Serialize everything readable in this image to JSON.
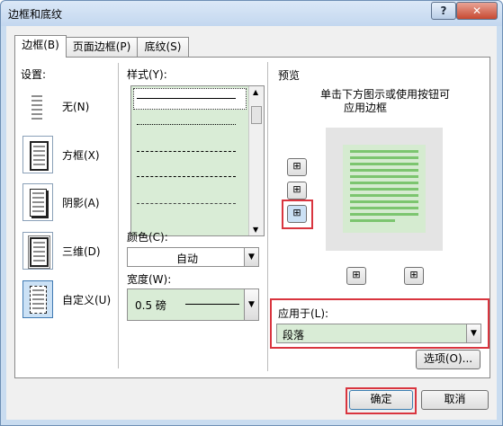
{
  "window": {
    "title": "边框和底纹",
    "help": "?",
    "close": "✕"
  },
  "tabs": [
    {
      "label": "边框(B)"
    },
    {
      "label": "页面边框(P)"
    },
    {
      "label": "底纹(S)"
    }
  ],
  "settings": {
    "label": "设置:",
    "items": [
      {
        "label": "无(N)"
      },
      {
        "label": "方框(X)"
      },
      {
        "label": "阴影(A)"
      },
      {
        "label": "三维(D)"
      },
      {
        "label": "自定义(U)"
      }
    ]
  },
  "style": {
    "label": "样式(Y):"
  },
  "color": {
    "label": "颜色(C):",
    "value": "自动"
  },
  "width": {
    "label": "宽度(W):",
    "value": "0.5 磅"
  },
  "preview": {
    "label": "预览",
    "hint_line1": "单击下方图示或使用按钮可",
    "hint_line2": "应用边框"
  },
  "apply": {
    "label": "应用于(L):",
    "value": "段落"
  },
  "buttons": {
    "options": "选项(O)...",
    "ok": "确定",
    "cancel": "取消"
  },
  "colors": {
    "accent_red": "#d9353f",
    "preview_green": "#d5ebd0",
    "lines_green": "#7cc56f"
  }
}
